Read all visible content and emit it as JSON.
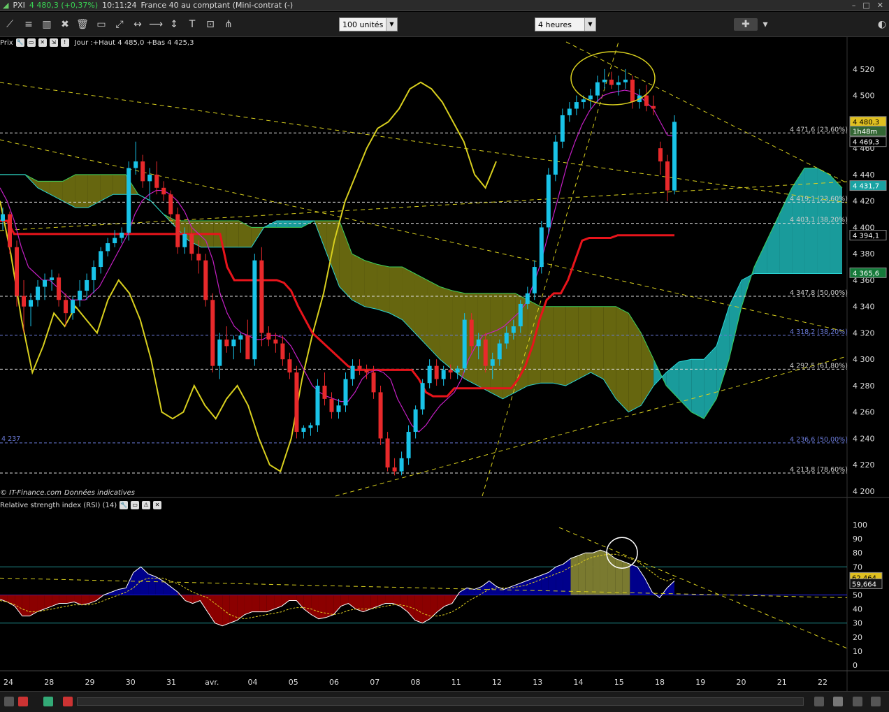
{
  "window": {
    "symbol": "PXI",
    "price": "4 480,3 (+0,37%)",
    "time": "10:11:24",
    "title": "France 40 au comptant (Mini-contrat (-)"
  },
  "toolbar": {
    "units_select": "100 unités",
    "period_select": "4 heures"
  },
  "price_panel": {
    "label": "Prix",
    "info": "Jour :+Haut 4 485,0 +Bas 4 425,3",
    "watermark": "© IT-Finance.com",
    "watermark_note": "Données indicatives"
  },
  "rsi_panel": {
    "label": "Relative strength index (RSI) (14)"
  },
  "colors": {
    "bull": "#19c3e8",
    "bear": "#e8292b",
    "kijun": "#e8141b",
    "tenkan": "#c41fc4",
    "chikou": "#d8cf1e",
    "kumo_olive": "#6b6b10",
    "kumo_teal": "#1aa3a3",
    "rsi_red": "#8b0000",
    "rsi_blue": "#00008b",
    "rsi_olive": "#7a7a30"
  },
  "chart_data": [
    {
      "type": "candlestick",
      "y_axis": {
        "min": 4200,
        "max": 4530,
        "ticks": [
          "4 520",
          "4 500",
          "4 480",
          "4 460",
          "4 440",
          "4 420",
          "4 400",
          "4 380",
          "4 360",
          "4 340",
          "4 320",
          "4 300",
          "4 280",
          "4 260",
          "4 240",
          "4 220",
          "4 200"
        ],
        "tick_values": [
          4520,
          4500,
          4480,
          4460,
          4440,
          4420,
          4400,
          4380,
          4360,
          4340,
          4320,
          4300,
          4280,
          4260,
          4240,
          4220,
          4200
        ]
      },
      "x_labels": [
        "24",
        "28",
        "29",
        "30",
        "31",
        "avr.",
        "04",
        "05",
        "06",
        "07",
        "08",
        "11",
        "12",
        "13",
        "14",
        "15",
        "18",
        "19",
        "20",
        "21",
        "22"
      ],
      "fibonacci_levels": [
        {
          "label": "4 471,6 (23,60%)",
          "value": 4471.6
        },
        {
          "label": "4 419,1 (23,60%)",
          "value": 4419.1
        },
        {
          "label": "4 403,1 (38,20%)",
          "value": 4403.1
        },
        {
          "label": "4 347,8 (50,00%)",
          "value": 4347.8
        },
        {
          "label": "4 318,2 (38,20%)",
          "value": 4318.2
        },
        {
          "label": "4 292,5 (61,80%)",
          "value": 4292.5
        },
        {
          "label": "4 236,6 (50,00%)",
          "value": 4236.6
        },
        {
          "label": "4 213,8 (78,60%)",
          "value": 4213.8
        }
      ],
      "left_level_label": "4 237",
      "price_badges": [
        {
          "text": "4 480,3",
          "value": 4480.3,
          "color": "#e0c020"
        },
        {
          "text": "1h48m",
          "value": 4473,
          "color": "#336633"
        },
        {
          "text": "4 469,3",
          "value": 4465,
          "color": "#000000"
        },
        {
          "text": "4 431,7",
          "value": 4431.7,
          "color": "#1aa3a3"
        },
        {
          "text": "4 394,1",
          "value": 4394.1,
          "color": "#000000"
        },
        {
          "text": "4 365,6",
          "value": 4365.6,
          "color": "#157a3a"
        }
      ],
      "candles": [
        [
          4405,
          4415,
          4398,
          4410
        ],
        [
          4410,
          4412,
          4380,
          4385
        ],
        [
          4385,
          4390,
          4340,
          4348
        ],
        [
          4348,
          4360,
          4320,
          4340
        ],
        [
          4340,
          4350,
          4325,
          4345
        ],
        [
          4345,
          4360,
          4340,
          4355
        ],
        [
          4355,
          4365,
          4345,
          4360
        ],
        [
          4360,
          4368,
          4352,
          4362
        ],
        [
          4362,
          4365,
          4340,
          4345
        ],
        [
          4345,
          4350,
          4325,
          4335
        ],
        [
          4335,
          4348,
          4330,
          4345
        ],
        [
          4345,
          4360,
          4340,
          4352
        ],
        [
          4352,
          4365,
          4345,
          4360
        ],
        [
          4360,
          4375,
          4350,
          4370
        ],
        [
          4370,
          4385,
          4365,
          4382
        ],
        [
          4382,
          4392,
          4378,
          4388
        ],
        [
          4388,
          4398,
          4385,
          4392
        ],
        [
          4392,
          4400,
          4388,
          4396
        ],
        [
          4396,
          4450,
          4390,
          4445
        ],
        [
          4445,
          4465,
          4440,
          4450
        ],
        [
          4450,
          4455,
          4430,
          4435
        ],
        [
          4435,
          4445,
          4420,
          4440
        ],
        [
          4440,
          4450,
          4425,
          4430
        ],
        [
          4430,
          4435,
          4420,
          4425
        ],
        [
          4425,
          4428,
          4405,
          4410
        ],
        [
          4410,
          4415,
          4380,
          4385
        ],
        [
          4385,
          4400,
          4380,
          4395
        ],
        [
          4395,
          4400,
          4375,
          4380
        ],
        [
          4380,
          4390,
          4365,
          4375
        ],
        [
          4375,
          4380,
          4340,
          4345
        ],
        [
          4345,
          4350,
          4290,
          4295
        ],
        [
          4295,
          4320,
          4285,
          4315
        ],
        [
          4315,
          4325,
          4305,
          4310
        ],
        [
          4310,
          4318,
          4300,
          4315
        ],
        [
          4315,
          4320,
          4305,
          4318
        ],
        [
          4318,
          4330,
          4310,
          4300
        ],
        [
          4300,
          4380,
          4295,
          4375
        ],
        [
          4375,
          4385,
          4310,
          4320
        ],
        [
          4320,
          4325,
          4310,
          4315
        ],
        [
          4315,
          4320,
          4305,
          4312
        ],
        [
          4312,
          4318,
          4295,
          4300
        ],
        [
          4300,
          4305,
          4285,
          4290
        ],
        [
          4290,
          4295,
          4240,
          4245
        ],
        [
          4245,
          4250,
          4240,
          4248
        ],
        [
          4248,
          4252,
          4242,
          4250
        ],
        [
          4250,
          4285,
          4245,
          4280
        ],
        [
          4280,
          4290,
          4265,
          4270
        ],
        [
          4270,
          4275,
          4255,
          4260
        ],
        [
          4260,
          4270,
          4255,
          4265
        ],
        [
          4265,
          4290,
          4260,
          4285
        ],
        [
          4285,
          4300,
          4280,
          4295
        ],
        [
          4295,
          4300,
          4288,
          4292
        ],
        [
          4292,
          4296,
          4285,
          4290
        ],
        [
          4290,
          4295,
          4270,
          4275
        ],
        [
          4275,
          4280,
          4235,
          4240
        ],
        [
          4240,
          4245,
          4215,
          4218
        ],
        [
          4218,
          4225,
          4212,
          4215
        ],
        [
          4215,
          4230,
          4212,
          4225
        ],
        [
          4225,
          4250,
          4220,
          4245
        ],
        [
          4245,
          4265,
          4240,
          4262
        ],
        [
          4262,
          4285,
          4258,
          4282
        ],
        [
          4282,
          4300,
          4278,
          4295
        ],
        [
          4295,
          4300,
          4280,
          4285
        ],
        [
          4285,
          4295,
          4280,
          4292
        ],
        [
          4292,
          4296,
          4285,
          4290
        ],
        [
          4290,
          4295,
          4285,
          4293
        ],
        [
          4293,
          4335,
          4290,
          4330
        ],
        [
          4330,
          4335,
          4305,
          4310
        ],
        [
          4310,
          4320,
          4300,
          4315
        ],
        [
          4315,
          4320,
          4290,
          4295
        ],
        [
          4295,
          4305,
          4285,
          4300
        ],
        [
          4300,
          4315,
          4295,
          4312
        ],
        [
          4312,
          4325,
          4308,
          4320
        ],
        [
          4320,
          4330,
          4315,
          4325
        ],
        [
          4325,
          4345,
          4320,
          4342
        ],
        [
          4342,
          4355,
          4338,
          4350
        ],
        [
          4350,
          4375,
          4345,
          4370
        ],
        [
          4370,
          4405,
          4365,
          4400
        ],
        [
          4400,
          4445,
          4395,
          4440
        ],
        [
          4440,
          4470,
          4435,
          4465
        ],
        [
          4465,
          4490,
          4460,
          4485
        ],
        [
          4485,
          4495,
          4480,
          4490
        ],
        [
          4490,
          4500,
          4485,
          4495
        ],
        [
          4495,
          4500,
          4490,
          4497
        ],
        [
          4497,
          4505,
          4490,
          4500
        ],
        [
          4500,
          4515,
          4495,
          4510
        ],
        [
          4510,
          4520,
          4505,
          4512
        ],
        [
          4512,
          4518,
          4505,
          4508
        ],
        [
          4508,
          4515,
          4500,
          4510
        ],
        [
          4510,
          4520,
          4505,
          4512
        ],
        [
          4512,
          4515,
          4490,
          4495
        ],
        [
          4495,
          4505,
          4490,
          4500
        ],
        [
          4500,
          4508,
          4488,
          4492
        ],
        [
          4492,
          4500,
          4485,
          4490
        ],
        [
          4460,
          4465,
          4440,
          4450
        ],
        [
          4450,
          4455,
          4420,
          4428
        ],
        [
          4428,
          4485,
          4425,
          4480
        ]
      ],
      "kijun": [
        4405,
        4405,
        4395,
        4395,
        4395,
        4395,
        4395,
        4395,
        4395,
        4395,
        4395,
        4395,
        4395,
        4395,
        4395,
        4395,
        4395,
        4395,
        4395,
        4395,
        4395,
        4395,
        4395,
        4395,
        4395,
        4395,
        4395,
        4395,
        4395,
        4395,
        4395,
        4395,
        4370,
        4360,
        4360,
        4360,
        4360,
        4360,
        4360,
        4360,
        4358,
        4352,
        4340,
        4330,
        4320,
        4315,
        4310,
        4305,
        4300,
        4295,
        4292,
        4292,
        4292,
        4292,
        4292,
        4292,
        4292,
        4292,
        4292,
        4285,
        4275,
        4272,
        4272,
        4272,
        4278,
        4278,
        4278,
        4278,
        4278,
        4278,
        4278,
        4278,
        4278,
        4285,
        4295,
        4310,
        4330,
        4345,
        4350,
        4350,
        4360,
        4375,
        4390,
        4392,
        4392,
        4392,
        4392,
        4394,
        4394,
        4394,
        4394,
        4394,
        4394,
        4394,
        4394,
        4394
      ],
      "tenkan": [
        4430,
        4420,
        4405,
        4385,
        4370,
        4365,
        4360,
        4360,
        4355,
        4350,
        4345,
        4345,
        4345,
        4350,
        4355,
        4365,
        4375,
        4385,
        4395,
        4410,
        4420,
        4425,
        4428,
        4428,
        4425,
        4420,
        4412,
        4400,
        4395,
        4390,
        4375,
        4350,
        4335,
        4325,
        4320,
        4318,
        4315,
        4315,
        4318,
        4318,
        4316,
        4310,
        4300,
        4290,
        4280,
        4275,
        4272,
        4270,
        4268,
        4268,
        4275,
        4285,
        4290,
        4292,
        4290,
        4285,
        4270,
        4260,
        4250,
        4245,
        4250,
        4258,
        4265,
        4270,
        4275,
        4285,
        4300,
        4310,
        4318,
        4320,
        4322,
        4325,
        4330,
        4335,
        4342,
        4355,
        4370,
        4390,
        4410,
        4430,
        4450,
        4465,
        4478,
        4488,
        4495,
        4500,
        4502,
        4503,
        4504,
        4503,
        4500,
        4495,
        4490,
        4480,
        4470,
        4469
      ],
      "chikou": [
        4420,
        4380,
        4330,
        4290,
        4310,
        4335,
        4325,
        4340,
        4330,
        4320,
        4345,
        4360,
        4350,
        4330,
        4300,
        4260,
        4255,
        4260,
        4280,
        4265,
        4255,
        4270,
        4280,
        4265,
        4240,
        4220,
        4215,
        4240,
        4285,
        4320,
        4350,
        4390,
        4420,
        4440,
        4460,
        4475,
        4480,
        4490,
        4505,
        4510,
        4505,
        4495,
        4480,
        4465,
        4440,
        4430,
        4450
      ],
      "kumo_top": [
        4440,
        4440,
        4440,
        4435,
        4435,
        4435,
        4440,
        4440,
        4440,
        4440,
        4440,
        4425,
        4420,
        4410,
        4405,
        4405,
        4405,
        4405,
        4405,
        4405,
        4400,
        4400,
        4400,
        4400,
        4400,
        4405,
        4405,
        4405,
        4380,
        4375,
        4372,
        4370,
        4370,
        4365,
        4360,
        4355,
        4352,
        4350,
        4350,
        4350,
        4350,
        4350,
        4345,
        4340,
        4340,
        4340,
        4340,
        4340,
        4340,
        4340,
        4335,
        4320,
        4300,
        4280,
        4270,
        4260,
        4255,
        4270,
        4300,
        4340,
        4370,
        4390,
        4410,
        4430,
        4445,
        4445,
        4440,
        4430
      ],
      "kumo_bottom": [
        4440,
        4440,
        4440,
        4430,
        4425,
        4420,
        4415,
        4415,
        4420,
        4425,
        4425,
        4425,
        4420,
        4410,
        4400,
        4390,
        4385,
        4385,
        4385,
        4385,
        4385,
        4400,
        4405,
        4405,
        4405,
        4405,
        4380,
        4355,
        4345,
        4340,
        4338,
        4335,
        4330,
        4320,
        4310,
        4300,
        4292,
        4285,
        4280,
        4275,
        4270,
        4275,
        4280,
        4282,
        4282,
        4280,
        4285,
        4290,
        4285,
        4270,
        4260,
        4265,
        4280,
        4290,
        4298,
        4300,
        4300,
        4310,
        4340,
        4360,
        4365,
        4365,
        4365,
        4365,
        4365,
        4365,
        4365,
        4365
      ]
    },
    {
      "type": "line",
      "name": "Relative strength index (RSI) (14)",
      "y_axis": {
        "min": 0,
        "max": 100,
        "ticks": [
          "100",
          "90",
          "80",
          "70",
          "60",
          "50",
          "40",
          "30",
          "20",
          "10",
          "0"
        ],
        "tick_values": [
          100,
          90,
          80,
          70,
          60,
          50,
          40,
          30,
          20,
          10,
          0
        ]
      },
      "badges": [
        {
          "text": "62,464",
          "value": 62.5
        },
        {
          "text": "59,664",
          "value": 58
        }
      ],
      "rsi": [
        47,
        45,
        42,
        35,
        35,
        38,
        40,
        42,
        44,
        44,
        45,
        43,
        44,
        46,
        50,
        52,
        54,
        55,
        66,
        70,
        65,
        63,
        60,
        56,
        52,
        46,
        44,
        46,
        38,
        30,
        28,
        30,
        32,
        36,
        38,
        38,
        38,
        40,
        42,
        46,
        46,
        40,
        36,
        33,
        34,
        36,
        42,
        44,
        40,
        38,
        40,
        42,
        44,
        44,
        42,
        38,
        32,
        30,
        33,
        38,
        42,
        44,
        52,
        55,
        54,
        56,
        60,
        56,
        54,
        56,
        58,
        60,
        62,
        64,
        66,
        70,
        72,
        76,
        78,
        80,
        80,
        82,
        80,
        76,
        74,
        72,
        70,
        62,
        52,
        48,
        55,
        60
      ],
      "rsi_avg": [
        46,
        45,
        43,
        40,
        38,
        38,
        39,
        40,
        41,
        42,
        43,
        43,
        43,
        44,
        46,
        48,
        50,
        52,
        55,
        60,
        62,
        62,
        62,
        60,
        58,
        55,
        52,
        50,
        48,
        44,
        40,
        36,
        34,
        33,
        34,
        35,
        36,
        37,
        38,
        40,
        41,
        41,
        40,
        38,
        37,
        36,
        37,
        39,
        40,
        40,
        40,
        41,
        42,
        43,
        43,
        42,
        40,
        37,
        35,
        35,
        36,
        38,
        41,
        45,
        48,
        51,
        54,
        55,
        55,
        55,
        56,
        57,
        59,
        61,
        63,
        65,
        67,
        70,
        72,
        75,
        77,
        78,
        79,
        79,
        78,
        76,
        74,
        70,
        66,
        62,
        60,
        62
      ]
    }
  ]
}
